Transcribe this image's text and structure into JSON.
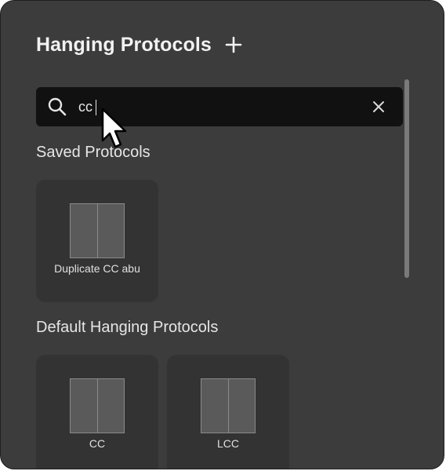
{
  "header": {
    "title": "Hanging Protocols",
    "add_icon": "plus-icon"
  },
  "search": {
    "value": "cc",
    "icon": "search-icon",
    "clear_icon": "close-icon"
  },
  "sections": {
    "saved": {
      "title": "Saved Protocols",
      "items": [
        {
          "label": "Duplicate CC abu"
        }
      ]
    },
    "default": {
      "title": "Default Hanging Protocols",
      "items": [
        {
          "label": "CC"
        },
        {
          "label": "LCC"
        }
      ]
    }
  },
  "colors": {
    "panel_bg": "#3c3c3c",
    "search_bg": "#111111",
    "card_bg": "#333333",
    "text": "#f2f2f2"
  }
}
